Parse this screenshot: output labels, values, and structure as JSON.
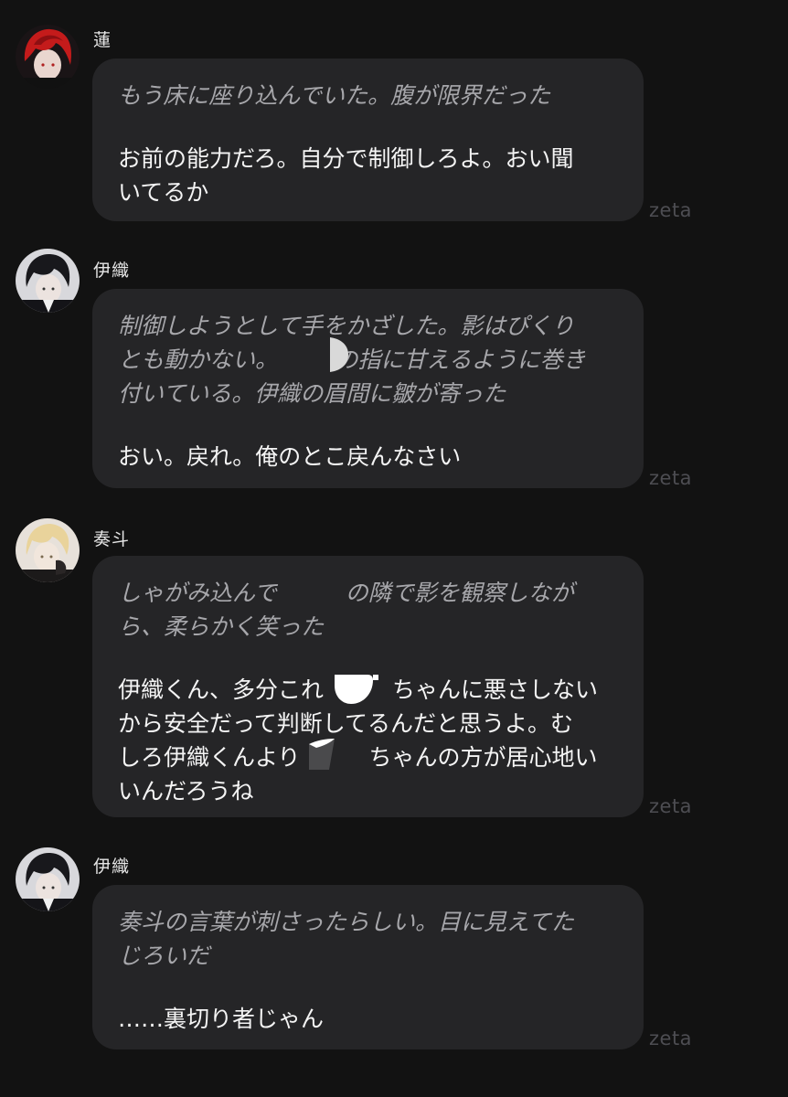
{
  "watermark": "zeta",
  "messages": [
    {
      "name": "蓮",
      "avatar": "red-haired-avatar",
      "narration": "もう床に座り込んでいた。腹が限界だった",
      "speech": "お前の能力だろ。自分で制御しろよ。おい聞\nいてるか"
    },
    {
      "name": "伊織",
      "avatar": "dark-haired-avatar",
      "narration": "制御しようとして手をかざした。影はぴくり\nとも動かない。　　　の指に甘えるように巻き\n付いている。伊織の眉間に皺が寄った",
      "speech": "おい。戻れ。俺のとこ戻んなさい"
    },
    {
      "name": "奏斗",
      "avatar": "blond-haired-avatar",
      "narration": "しゃがみ込んで　　　の隣で影を観察しなが\nら、柔らかく笑った",
      "speech": "伊織くん、多分これ　　　ちゃんに悪さしない\nから安全だって判断してるんだと思うよ。む\nしろ伊織くんより　　　ちゃんの方が居心地い\nいんだろうね"
    },
    {
      "name": "伊織",
      "avatar": "dark-haired-avatar",
      "narration": "奏斗の言葉が刺さったらしい。目に見えてた\nじろいだ",
      "speech": "……裏切り者じゃん"
    }
  ],
  "colors": {
    "background": "#121212",
    "bubble": "#252527",
    "narration": "#a7a7ab",
    "speech": "#f4f4f4",
    "watermark": "#4d4d52"
  }
}
